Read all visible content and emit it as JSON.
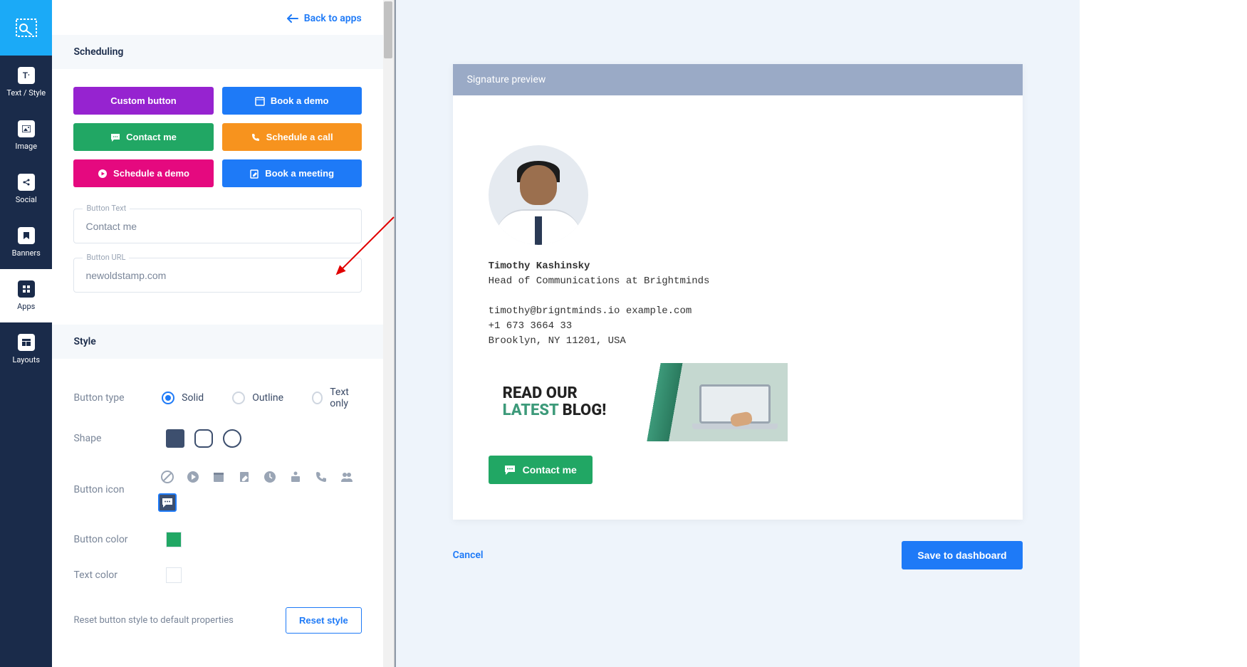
{
  "nav": {
    "back": "Back to apps",
    "items": [
      {
        "label": "Text / Style"
      },
      {
        "label": "Image"
      },
      {
        "label": "Social"
      },
      {
        "label": "Banners"
      },
      {
        "label": "Apps"
      },
      {
        "label": "Layouts"
      }
    ]
  },
  "scheduling": {
    "title": "Scheduling",
    "buttons": {
      "custom": "Custom button",
      "book_demo": "Book a demo",
      "contact_me": "Contact me",
      "schedule_call": "Schedule a call",
      "schedule_demo": "Schedule a demo",
      "book_meeting": "Book a meeting"
    },
    "fields": {
      "button_text_label": "Button Text",
      "button_text_value": "Contact me",
      "button_url_label": "Button URL",
      "button_url_value": "newoldstamp.com"
    }
  },
  "style": {
    "title": "Style",
    "button_type_label": "Button type",
    "types": {
      "solid": "Solid",
      "outline": "Outline",
      "text_only": "Text only"
    },
    "shape_label": "Shape",
    "icon_label": "Button icon",
    "color_label": "Button color",
    "text_color_label": "Text color",
    "reset_text": "Reset button style to default properties",
    "reset_button": "Reset style",
    "button_color": "#21a764",
    "text_color": "#ffffff"
  },
  "preview": {
    "header": "Signature preview",
    "name": "Timothy Kashinsky",
    "title": "Head of Communications at Brightminds",
    "email1": "timothy@brigntminds.io",
    "email2": "example.com",
    "phone": "+1 673 3664 33",
    "address": "Brooklyn, NY 11201, USA",
    "banner_line1": "READ OUR",
    "banner_line2a": "LATEST",
    "banner_line2b": " BLOG!",
    "cta": "Contact me"
  },
  "actions": {
    "cancel": "Cancel",
    "save": "Save to dashboard"
  }
}
